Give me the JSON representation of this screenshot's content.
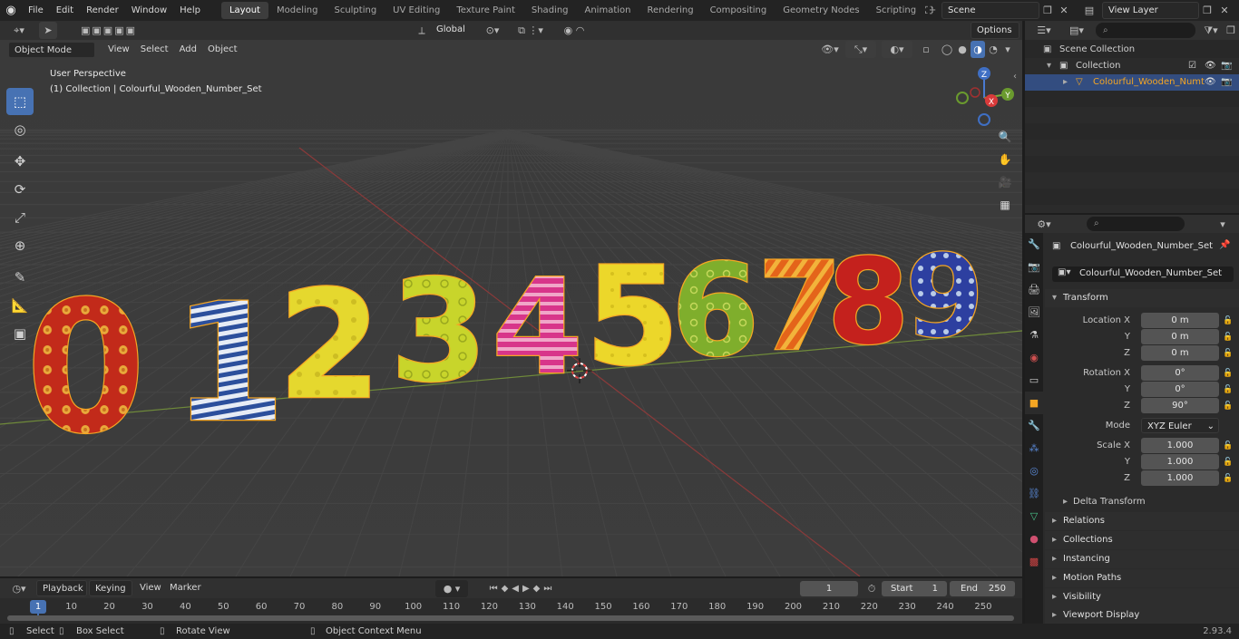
{
  "topbar": {
    "menus": [
      "File",
      "Edit",
      "Render",
      "Window",
      "Help"
    ],
    "workspaces": [
      "Layout",
      "Modeling",
      "Sculpting",
      "UV Editing",
      "Texture Paint",
      "Shading",
      "Animation",
      "Rendering",
      "Compositing",
      "Geometry Nodes",
      "Scripting"
    ],
    "active_workspace": "Layout",
    "scene": "Scene",
    "view_layer": "View Layer"
  },
  "viewport_header": {
    "mode": "Object Mode",
    "menus": [
      "View",
      "Select",
      "Add",
      "Object"
    ],
    "transform_orientation": "Global",
    "options_label": "Options"
  },
  "viewport": {
    "view_name": "User Perspective",
    "collection_info": "(1) Collection | Colourful_Wooden_Number_Set",
    "digits": [
      "0",
      "1",
      "2",
      "3",
      "4",
      "5",
      "6",
      "7",
      "8",
      "9"
    ],
    "gizmo_labels": {
      "x": "X",
      "y": "Y",
      "z": "Z"
    }
  },
  "outliner": {
    "scene_collection": "Scene Collection",
    "collection": "Collection",
    "object": "Colourful_Wooden_Numt"
  },
  "properties": {
    "object_name": "Colourful_Wooden_Number_Set",
    "data_name": "Colourful_Wooden_Number_Set",
    "transform_label": "Transform",
    "location": {
      "label": "Location X",
      "x": "0 m",
      "y": "0 m",
      "z": "0 m"
    },
    "rotation": {
      "label": "Rotation X",
      "x": "0°",
      "y": "0°",
      "z": "90°"
    },
    "mode_label": "Mode",
    "mode_value": "XYZ Euler",
    "scale": {
      "label": "Scale X",
      "x": "1.000",
      "y": "1.000",
      "z": "1.000"
    },
    "axis_y": "Y",
    "axis_z": "Z",
    "delta_transform": "Delta Transform",
    "sections": [
      "Relations",
      "Collections",
      "Instancing",
      "Motion Paths",
      "Visibility",
      "Viewport Display"
    ]
  },
  "timeline": {
    "menus": [
      "Playback",
      "Keying",
      "View",
      "Marker"
    ],
    "current_frame": "1",
    "start_label": "Start",
    "start_value": "1",
    "end_label": "End",
    "end_value": "250",
    "ruler_marks": [
      "1",
      "10",
      "20",
      "30",
      "40",
      "50",
      "60",
      "70",
      "80",
      "90",
      "100",
      "110",
      "120",
      "130",
      "140",
      "150",
      "160",
      "170",
      "180",
      "190",
      "200",
      "210",
      "220",
      "230",
      "240",
      "250"
    ]
  },
  "statusbar": {
    "select": "Select",
    "box_select": "Box Select",
    "rotate_view": "Rotate View",
    "context_menu": "Object Context Menu",
    "version": "2.93.4"
  },
  "colors": {
    "accent": "#4772b3",
    "active_orange": "#f5a623",
    "viewport_bg": "#3a3a3a"
  }
}
